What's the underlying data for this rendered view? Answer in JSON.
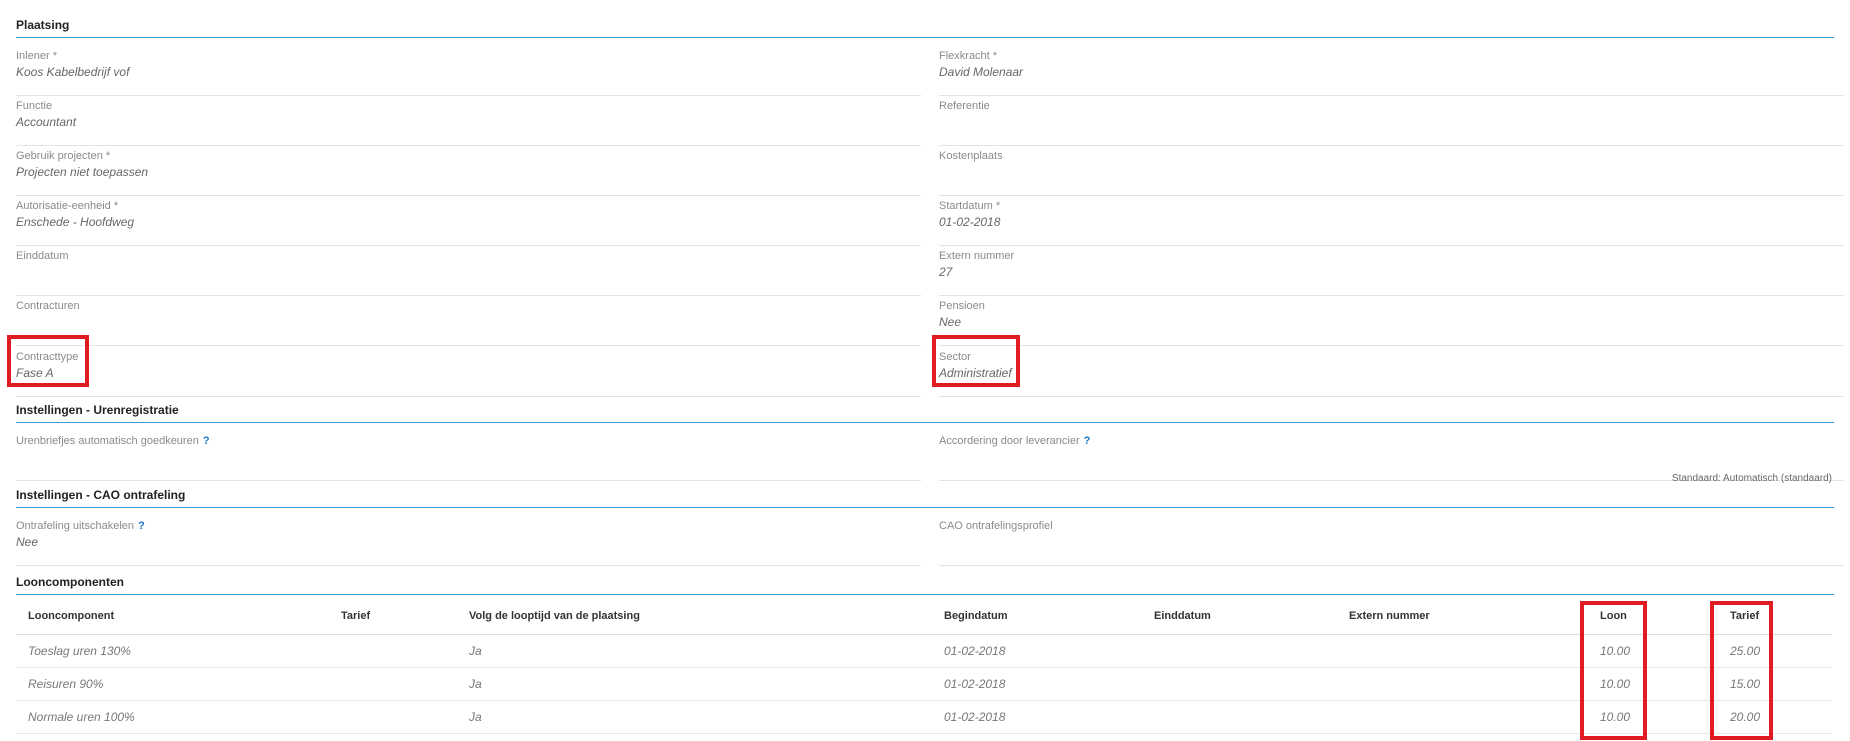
{
  "plaatsing": {
    "title": "Plaatsing",
    "left": [
      {
        "label": "Inlener *",
        "value": "Koos Kabelbedrijf vof"
      },
      {
        "label": "Functie",
        "value": "Accountant"
      },
      {
        "label": "Gebruik projecten *",
        "value": "Projecten niet toepassen"
      },
      {
        "label": "Autorisatie-eenheid *",
        "value": "Enschede - Hoofdweg"
      },
      {
        "label": "Einddatum",
        "value": ""
      },
      {
        "label": "Contracturen",
        "value": ""
      },
      {
        "label": "Contracttype",
        "value": "Fase A"
      }
    ],
    "right": [
      {
        "label": "Flexkracht *",
        "value": " David Molenaar"
      },
      {
        "label": "Referentie",
        "value": ""
      },
      {
        "label": "Kostenplaats",
        "value": ""
      },
      {
        "label": "Startdatum *",
        "value": "01-02-2018"
      },
      {
        "label": "Extern nummer",
        "value": "27"
      },
      {
        "label": "Pensioen",
        "value": "Nee"
      },
      {
        "label": "Sector",
        "value": "Administratief"
      }
    ]
  },
  "urenregistratie": {
    "title": "Instellingen - Urenregistratie",
    "left": {
      "label": "Urenbriefjes automatisch goedkeuren",
      "value": "",
      "help": "?"
    },
    "right": {
      "label": "Accordering door leverancier",
      "value": "",
      "help": "?"
    },
    "note": "Standaard: Automatisch (standaard)"
  },
  "cao": {
    "title": "Instellingen - CAO ontrafeling",
    "left": {
      "label": "Ontrafeling uitschakelen",
      "value": "Nee",
      "help": "?"
    },
    "right": {
      "label": "CAO ontrafelingsprofiel",
      "value": ""
    }
  },
  "looncomponenten": {
    "title": "Looncomponenten",
    "columns": [
      "Looncomponent",
      "Tarief",
      "Volg de looptijd van de plaatsing",
      "Begindatum",
      "Einddatum",
      "Extern nummer",
      "Loon",
      "Tarief"
    ],
    "rows": [
      [
        "Toeslag uren 130%",
        "",
        "Ja",
        "01-02-2018",
        "",
        "",
        "10.00",
        "25.00"
      ],
      [
        "Reisuren 90%",
        "",
        "Ja",
        "01-02-2018",
        "",
        "",
        "10.00",
        "15.00"
      ],
      [
        "Normale uren 100%",
        "",
        "Ja",
        "01-02-2018",
        "",
        "",
        "10.00",
        "20.00"
      ]
    ]
  },
  "colors": {
    "accent": "#3a96d2",
    "highlight": "#e11b22",
    "help": "#1a75c9"
  }
}
